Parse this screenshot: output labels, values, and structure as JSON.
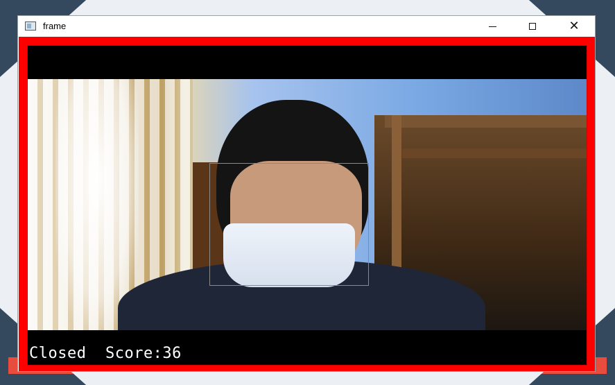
{
  "window": {
    "title": "frame",
    "minimize_label": "—",
    "maximize_label": "☐",
    "close_label": "✕"
  },
  "overlay": {
    "status_text": "Closed  Score:36"
  },
  "colors": {
    "frame_border": "#ff0000",
    "desktop_accent": "#e74c3c",
    "desktop_dark": "#34495e",
    "face_box": "#8a8a8a"
  },
  "icons": {
    "app": "app-window-icon",
    "minimize": "minimize-icon",
    "maximize": "maximize-icon",
    "close": "close-icon"
  }
}
